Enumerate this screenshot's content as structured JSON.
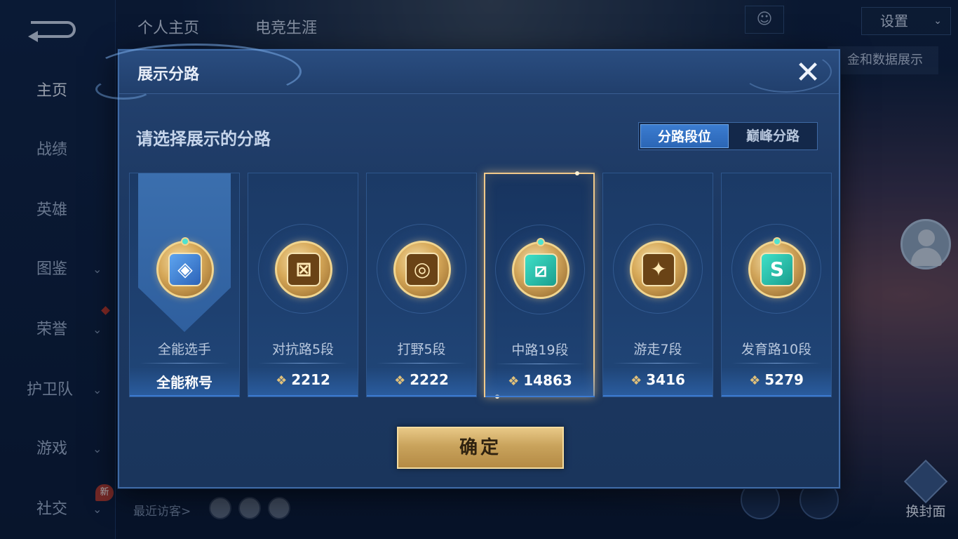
{
  "background": {
    "nav": {
      "items": [
        {
          "label": "主页",
          "active": true
        },
        {
          "label": "战绩"
        },
        {
          "label": "英雄"
        },
        {
          "label": "图鉴",
          "chevron": "⌄"
        },
        {
          "label": "荣誉",
          "chevron": "⌄"
        },
        {
          "label": "护卫队",
          "chevron": "⌄"
        },
        {
          "label": "游戏",
          "chevron": "⌄"
        },
        {
          "label": "社交",
          "chevron": "⌄"
        }
      ],
      "new_badge": "新"
    },
    "top_tabs": [
      "个人主页",
      "电竞生涯"
    ],
    "settings_label": "设置",
    "settings_chevron": "⌄",
    "peek_button_label": "金和数据展示",
    "visitors_label": "最近访客>",
    "cover_button_label": "换封面"
  },
  "modal": {
    "title": "展示分路",
    "close_glyph": "✕",
    "section_title": "请选择展示的分路",
    "toggle": {
      "options": [
        "分路段位",
        "巅峰分路"
      ],
      "selected_index": 0
    },
    "cards": [
      {
        "name": "全能选手",
        "footer": "全能称号",
        "has_score": false,
        "badge_glyph": "◈",
        "badge_style": "blue",
        "selected": false
      },
      {
        "name": "对抗路5段",
        "score": "2212",
        "has_score": true,
        "badge_glyph": "⊠",
        "badge_style": "gold",
        "selected": false
      },
      {
        "name": "打野5段",
        "score": "2222",
        "has_score": true,
        "badge_glyph": "◎",
        "badge_style": "gold",
        "selected": false
      },
      {
        "name": "中路19段",
        "score": "14863",
        "has_score": true,
        "badge_glyph": "⧄",
        "badge_style": "teal",
        "selected": true
      },
      {
        "name": "游走7段",
        "score": "3416",
        "has_score": true,
        "badge_glyph": "✦",
        "badge_style": "gold",
        "selected": false
      },
      {
        "name": "发育路10段",
        "score": "5279",
        "has_score": true,
        "badge_glyph": "S",
        "badge_style": "teal",
        "selected": false
      }
    ],
    "score_icon": "❖",
    "confirm_label": "确定"
  },
  "colors": {
    "accent_blue": "#2b66b6",
    "gold": "#c9a35c",
    "selected_border": "#f0c98a"
  }
}
